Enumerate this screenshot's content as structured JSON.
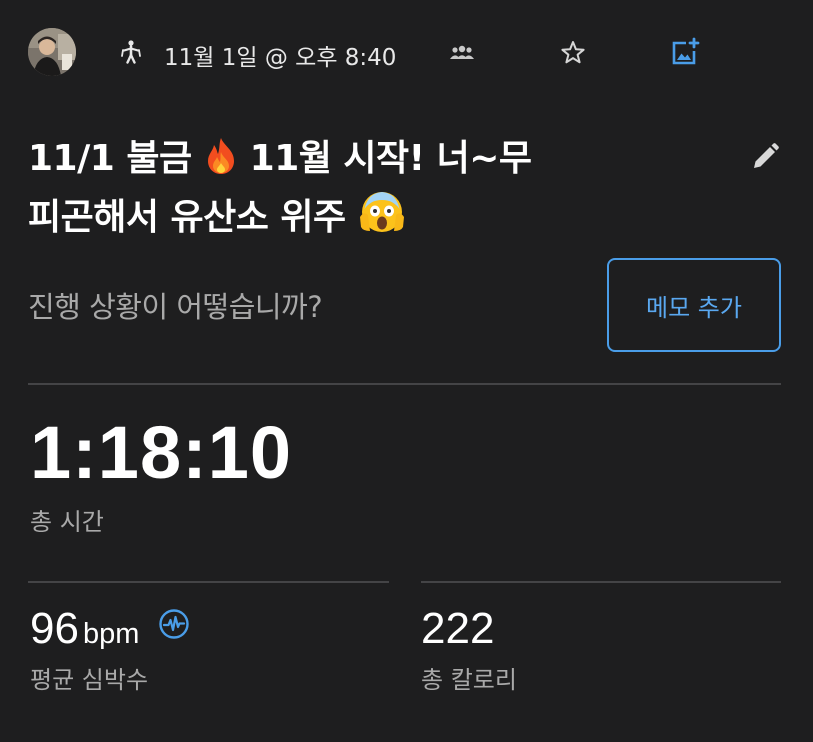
{
  "header": {
    "avatar_icon": "user-avatar-photo",
    "activity_icon": "jump-rope-person-icon",
    "datetime": "11월 1일 @ 오후 8:40",
    "group_icon": "group-people-icon",
    "star_icon": "star-outline-icon",
    "add_photo_icon": "add-photo-icon"
  },
  "title": {
    "line1_part1": "11/1 불금",
    "line1_emoji": "fire-emoji",
    "line1_part2": " 11월 시작! 너~무",
    "line2_part1": "피곤해서 유산소 위주",
    "line2_emoji": "screaming-face-emoji",
    "edit_icon": "pencil-icon"
  },
  "memo": {
    "prompt": "진행 상황이 어떻습니까?",
    "button_label": "메모 추가"
  },
  "stats": {
    "total_time_value": "1:18:10",
    "total_time_label": "총 시간",
    "avg_hr_value": "96",
    "avg_hr_unit": "bpm",
    "avg_hr_icon": "heart-rate-icon",
    "avg_hr_label": "평균 심박수",
    "calories_value": "222",
    "calories_label": "총 칼로리"
  },
  "colors": {
    "background": "#1e1e1f",
    "accent": "#4a9de8",
    "text_primary": "#ffffff",
    "text_secondary": "#a9a9a9",
    "divider": "#444446"
  }
}
